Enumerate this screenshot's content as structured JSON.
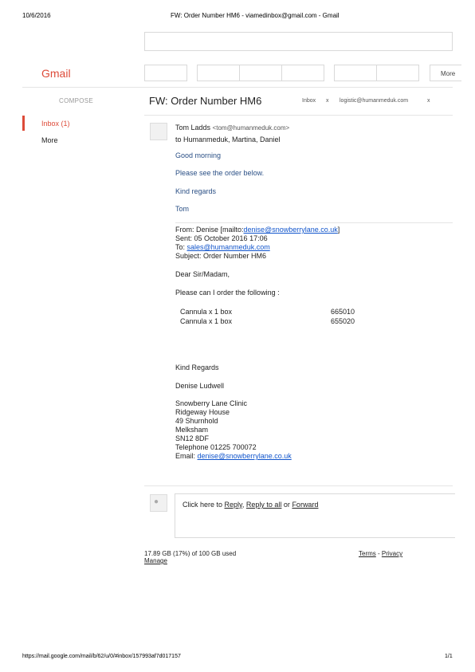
{
  "print_header": {
    "date": "10/6/2016",
    "title": "FW: Order Number HM6 - viamedinbox@gmail.com - Gmail"
  },
  "print_footer": {
    "url": "https://mail.google.com/mail/b/62/u/0/#inbox/157993af7d017157",
    "page": "1/1"
  },
  "app": {
    "logo": "Gmail"
  },
  "toolbar": {
    "more_label": "More"
  },
  "sidebar": {
    "compose_label": "COMPOSE",
    "inbox_label": "Inbox (1)",
    "more_label": "More"
  },
  "thread": {
    "subject": "FW: Order Number HM6",
    "labels": [
      {
        "text": "Inbox",
        "close": "x"
      },
      {
        "text": "logistic@humanmeduk.com",
        "close": "x"
      }
    ]
  },
  "message": {
    "sender_name": "Tom Ladds",
    "sender_email": "<tom@humanmeduk.com>",
    "recipients": "to Humanmeduk, Martina, Daniel",
    "greeting": "Good morning",
    "line1": "Please see the order below.",
    "signoff": "Kind regards",
    "signature": "Tom",
    "forwarded": {
      "from_prefix": "From: Denise [mailto:",
      "from_email": "denise@snowberrylane.co.uk",
      "from_suffix": "]",
      "sent": "Sent: 05 October 2016 17:06",
      "to_prefix": "To: ",
      "to_email": "sales@humanmeduk.com",
      "subject": "Subject: Order Number HM6",
      "salutation": "Dear Sir/Madam,",
      "request": "Please can I order the following :",
      "items": [
        {
          "name": "Cannula x 1 box",
          "code": "665010"
        },
        {
          "name": "Cannula  x 1 box",
          "code": "655020"
        }
      ],
      "closing": "Kind Regards",
      "name": "Denise Ludwell",
      "address": [
        "Snowberry Lane Clinic",
        "Ridgeway House",
        "49 Shurnhold",
        "Melksham",
        "SN12 8DF",
        "Telephone 01225 700072"
      ],
      "email_prefix": "Email: ",
      "email": "denise@snowberrylane.co.uk"
    }
  },
  "reply_box": {
    "prefix": "Click here to ",
    "reply": "Reply",
    "sep1": ", ",
    "reply_all": "Reply to all",
    "sep2": " or ",
    "forward": "Forward"
  },
  "footer": {
    "storage": "17.89 GB (17%) of 100 GB used",
    "manage": "Manage",
    "terms": "Terms",
    "dash": " - ",
    "privacy": "Privacy"
  }
}
